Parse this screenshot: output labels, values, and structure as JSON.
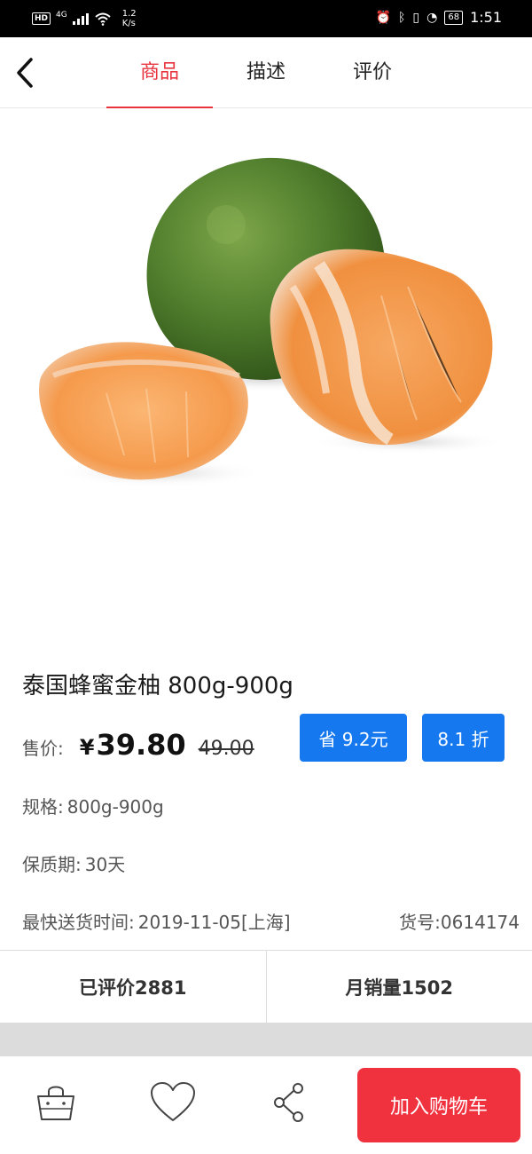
{
  "status_bar": {
    "hd": "HD",
    "network": "4G",
    "speed_value": "1.2",
    "speed_unit": "K/s",
    "battery": "68",
    "time": "1:51",
    "icons": [
      "alarm-icon",
      "bluetooth-icon",
      "vibrate-icon",
      "dnd-icon"
    ]
  },
  "header": {
    "back_icon": "chevron-left-icon",
    "tabs": [
      {
        "label": "商品",
        "active": true
      },
      {
        "label": "描述",
        "active": false
      },
      {
        "label": "评价",
        "active": false
      }
    ]
  },
  "product": {
    "image": "pomelo-photo",
    "title": "泰国蜂蜜金柚 800g-900g",
    "price_label": "售价:",
    "currency": "¥",
    "price": "39.80",
    "original_price": "49.00",
    "save_badge": "省 9.2元",
    "discount_badge": "8.1 折",
    "spec_label": "规格:",
    "spec_value": "800g-900g",
    "shelf_life_label": "保质期:",
    "shelf_life_value": "30天",
    "delivery_label": "最快送货时间:",
    "delivery_value": "2019-11-05[上海]",
    "item_no_label": "货号:",
    "item_no_value": "0614174"
  },
  "stats": {
    "reviewed": "已评价2881",
    "monthly_sales": "月销量1502"
  },
  "bottom_bar": {
    "cart_icon": "shopping-bag-icon",
    "favorite_icon": "heart-icon",
    "share_icon": "share-icon",
    "add_to_cart": "加入购物车"
  },
  "colors": {
    "accent_red": "#e8343f",
    "button_red": "#f0323f",
    "badge_blue": "#1578ef"
  }
}
